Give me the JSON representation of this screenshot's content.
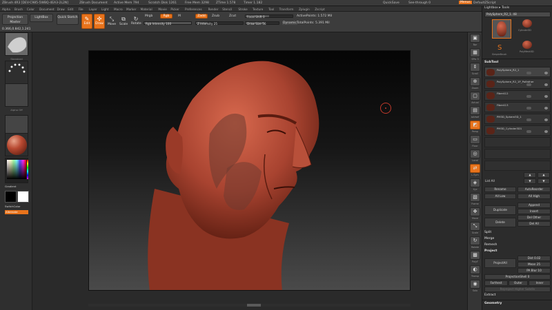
{
  "title_bar": {
    "app": "ZBrush 4R3 [DEV-C985-5WBQ-4EA3-2L2N]",
    "document": "ZBrush Document",
    "active_mem": "Active Mem 794",
    "scratch_disk": "Scratch Disk 1261",
    "free_mem": "Free Mem 3298",
    "ztime": "ZTime 1.578",
    "timer": "Timer 1.182",
    "quicksave": "QuickSave",
    "seethrough": "See-through  0",
    "menus_btn": "Menus",
    "default_script": "DefaultZScript"
  },
  "menubar": [
    "Alpha",
    "Brush",
    "Color",
    "Document",
    "Draw",
    "Edit",
    "File",
    "Layer",
    "Light",
    "Macro",
    "Marker",
    "Material",
    "Movie",
    "Picker",
    "Preferences",
    "Render",
    "Stencil",
    "Stroke",
    "Texture",
    "Tool",
    "Transform",
    "Zplugin",
    "Zscript"
  ],
  "toolbar": {
    "projection_master": "Projection Master",
    "lightbox": "LightBox",
    "quick_sketch": "Quick Sketch",
    "coords": "0.366,0.842,1.241",
    "edit": "Edit",
    "draw": "Draw",
    "move": "Move",
    "scale": "Scale",
    "rotate": "Rotate",
    "mrgb": "Mrgb",
    "rgb": "Rgb",
    "m": "M",
    "rgb_intensity": "Rgb Intensity 100",
    "rgb_intensity_value": 100,
    "zadd": "Zadd",
    "zsub": "Zsub",
    "zcut": "Zcut",
    "z_intensity": "Z Intensity 25",
    "z_intensity_value": 25,
    "focal_shift": "Focal Shift 0",
    "focal_shift_value": 0,
    "draw_size": "Draw Size 56",
    "draw_size_value": 56,
    "dynamic": "Dynamic",
    "active_points": "ActivePoints: 1.572 Mil",
    "total_points": "TotalPoints: 5.391 Mil"
  },
  "left_shelf": {
    "brush_caption": "Standard",
    "stroke_caption": "Dots",
    "alpha_caption": "Alpha Off",
    "texture_caption": "Texture Off",
    "material_caption": "",
    "gradient": "Gradient",
    "switch_color": "SwitchColor",
    "alternate": "Alternate"
  },
  "right_icons": [
    "Bpr",
    "SPix 3",
    "Scroll",
    "Zoom",
    "Actual",
    "AAHalf",
    "Persp",
    "Floor",
    "Local",
    "L.Sym",
    "Xyz",
    "Frame",
    "Move",
    "Scale",
    "Rotate",
    "PolyF",
    "Transp",
    "Solo"
  ],
  "right_panel": {
    "lightbox_tools": "Lightbox ▸ Tools",
    "current_tool": "PolySphere_R2_1. 48",
    "tools": [
      "PolySphere_R2",
      "Cylinder3D",
      "SimpleBrush",
      "PolyMesh3D"
    ],
    "subtool_header": "SubTool",
    "subtools": [
      "PolySphere_R2_1",
      "PolySphere_R2_1P_Polfather",
      "Fiber412",
      "Fiber413",
      "PM3D_Sphere3D_1",
      "PM3D_Cylinder3D1"
    ],
    "list_all": "List All",
    "rename": "Rename",
    "autoreorder": "AutoReorder",
    "all_low": "All Low",
    "all_high": "All High",
    "duplicate": "Duplicate",
    "append": "Append",
    "insert": "Insert",
    "delete": "Delete",
    "del_other": "Del Other",
    "del_all": "Del All",
    "split": "Split",
    "merge": "Merge",
    "remesh": "Remesh",
    "project": "Project",
    "project_all": "ProjectAll",
    "dist": "Dist 0.02",
    "mean": "Mean 25",
    "pa_blur": "PA Blur 10",
    "projection_shell": "ProjectionShell 0",
    "farthest": "Farthest",
    "outer": "Outer",
    "inner": "Inner",
    "reproject": "Reproject Higher Subdiv",
    "extract": "Extract",
    "geometry": "Geometry"
  }
}
